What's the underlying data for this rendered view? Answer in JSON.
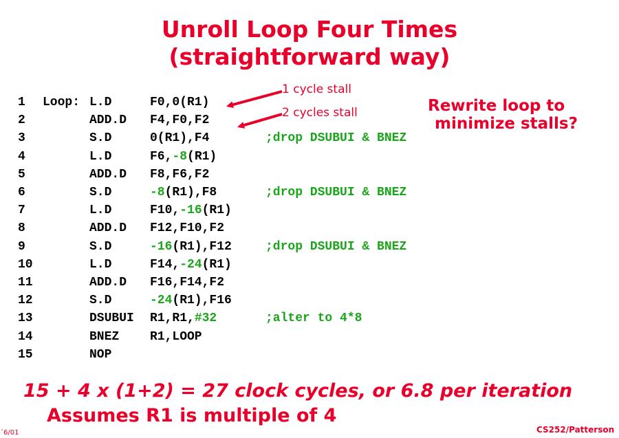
{
  "title": {
    "line1": "Unroll Loop Four Times",
    "line2": "(straightforward way)"
  },
  "code": [
    {
      "num": "1",
      "label": "Loop:",
      "op": "L.D",
      "args": [
        {
          "t": "F0,0(R1)"
        }
      ],
      "comment": ""
    },
    {
      "num": "2",
      "label": "",
      "op": "ADD.D",
      "args": [
        {
          "t": "F4,F0,F2"
        }
      ],
      "comment": ""
    },
    {
      "num": "3",
      "label": "",
      "op": "S.D",
      "args": [
        {
          "t": "0(R1),F4"
        }
      ],
      "comment": ";drop DSUBUI & BNEZ"
    },
    {
      "num": "4",
      "label": "",
      "op": "L.D",
      "args": [
        {
          "t": "F6,"
        },
        {
          "t": "-8",
          "g": true
        },
        {
          "t": "(R1)"
        }
      ],
      "comment": ""
    },
    {
      "num": "5",
      "label": "",
      "op": "ADD.D",
      "args": [
        {
          "t": "F8,F6,F2"
        }
      ],
      "comment": ""
    },
    {
      "num": "6",
      "label": "",
      "op": "S.D",
      "args": [
        {
          "t": "-8",
          "g": true
        },
        {
          "t": "(R1),F8"
        }
      ],
      "comment": ";drop DSUBUI & BNEZ"
    },
    {
      "num": "7",
      "label": "",
      "op": "L.D",
      "args": [
        {
          "t": "F10,"
        },
        {
          "t": "-16",
          "g": true
        },
        {
          "t": "(R1)"
        }
      ],
      "comment": ""
    },
    {
      "num": "8",
      "label": "",
      "op": "ADD.D",
      "args": [
        {
          "t": "F12,F10,F2"
        }
      ],
      "comment": ""
    },
    {
      "num": "9",
      "label": "",
      "op": "S.D",
      "args": [
        {
          "t": "-16",
          "g": true
        },
        {
          "t": "(R1),F12"
        }
      ],
      "comment": ";drop DSUBUI & BNEZ"
    },
    {
      "num": "10",
      "label": "",
      "op": "L.D",
      "args": [
        {
          "t": "F14,"
        },
        {
          "t": "-24",
          "g": true
        },
        {
          "t": "(R1)"
        }
      ],
      "comment": ""
    },
    {
      "num": "11",
      "label": "",
      "op": "ADD.D",
      "args": [
        {
          "t": "F16,F14,F2"
        }
      ],
      "comment": ""
    },
    {
      "num": "12",
      "label": "",
      "op": "S.D",
      "args": [
        {
          "t": "-24",
          "g": true
        },
        {
          "t": "(R1),F16"
        }
      ],
      "comment": ""
    },
    {
      "num": "13",
      "label": "",
      "op": "DSUBUI",
      "args": [
        {
          "t": "R1,R1,"
        },
        {
          "t": "#32",
          "g": true
        }
      ],
      "comment": ";alter to 4*8"
    },
    {
      "num": "14",
      "label": "",
      "op": "BNEZ",
      "args": [
        {
          "t": "R1,LOOP"
        }
      ],
      "comment": ""
    },
    {
      "num": "15",
      "label": "",
      "op": "NOP",
      "args": [],
      "comment": ""
    }
  ],
  "annotations": {
    "stall1": "1 cycle stall",
    "stall2": "2 cycles stall"
  },
  "side_question": {
    "line1": "Rewrite loop to",
    "line2": "minimize stalls?"
  },
  "formula": "15 + 4 x (1+2) = 27 clock cycles, or 6.8 per iteration",
  "assumption": "Assumes R1 is multiple of 4",
  "footer": {
    "left": "´6/01",
    "right": "CS252/Patterson"
  },
  "colors": {
    "title_red": "#e8002a",
    "code_black": "#000000",
    "comment_green": "#1aa51a"
  }
}
